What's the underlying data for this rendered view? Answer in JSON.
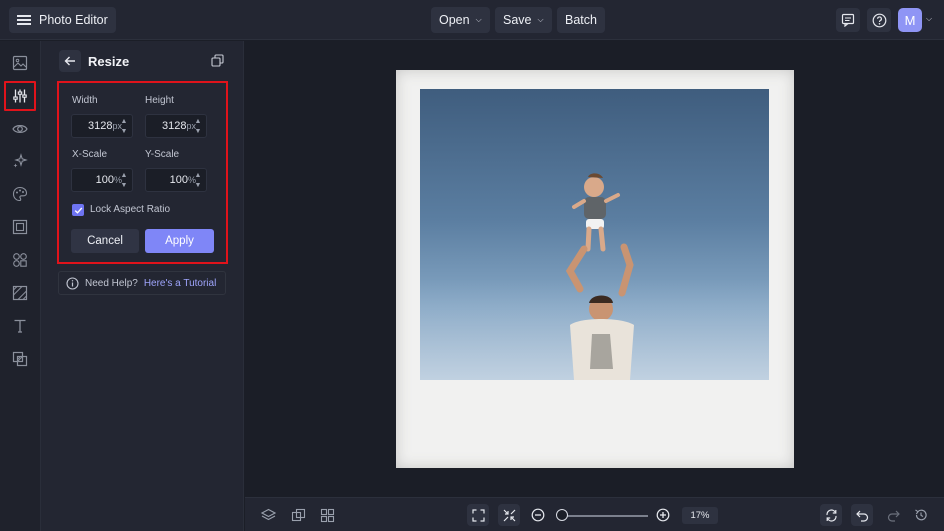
{
  "topbar": {
    "app_title": "Photo Editor",
    "menus": [
      {
        "label": "Open"
      },
      {
        "label": "Save"
      },
      {
        "label": "Batch"
      }
    ],
    "avatar_initial": "M"
  },
  "rail": {
    "items": [
      "image-icon",
      "adjust-sliders-icon",
      "eye-icon",
      "sparkle-icon",
      "palette-icon",
      "frame-icon",
      "elements-icon",
      "texture-icon",
      "text-icon",
      "overlay-icon"
    ],
    "active_index": 1
  },
  "panel": {
    "title": "Resize",
    "width_label": "Width",
    "height_label": "Height",
    "width_value": "3128",
    "height_value": "3128",
    "size_unit": "px",
    "xscale_label": "X-Scale",
    "yscale_label": "Y-Scale",
    "xscale_value": "100",
    "yscale_value": "100",
    "scale_unit": "%",
    "lock_label": "Lock Aspect Ratio",
    "lock_checked": true,
    "cancel_label": "Cancel",
    "apply_label": "Apply",
    "help_text": "Need Help?",
    "help_link": "Here's a Tutorial"
  },
  "bottombar": {
    "zoom": "17%"
  },
  "colors": {
    "accent": "#7f86f7",
    "highlight": "#e0131b",
    "background": "#1b1e27",
    "panel": "#232632"
  }
}
